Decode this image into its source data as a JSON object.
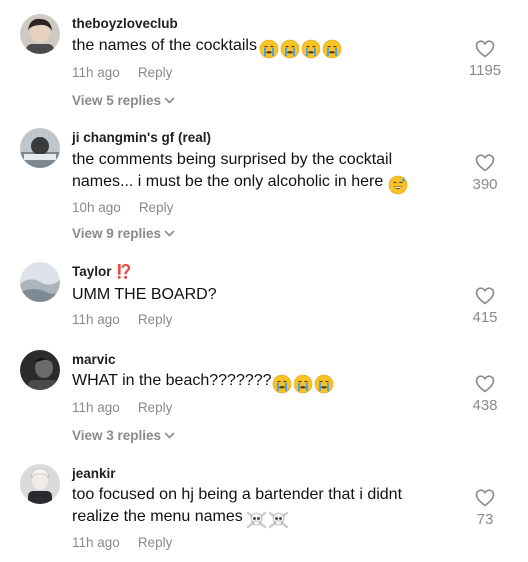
{
  "comments": [
    {
      "username": "theboyzloveclub",
      "badge": "",
      "text": "the names of the cocktails",
      "emojis": [
        "crying-face",
        "crying-face",
        "crying-face",
        "crying-face"
      ],
      "time": "11h ago",
      "reply_label": "Reply",
      "view_replies": "View 5 replies",
      "likes": "1195",
      "avatar_color": "#6b6b6b"
    },
    {
      "username": "ji changmin's gf (real)",
      "badge": "",
      "text_line1": "the comments being surprised by the cocktail",
      "text_line2": "names... i must be the only alcoholic in here",
      "emojis": [
        "sweat-smile-face"
      ],
      "time": "10h ago",
      "reply_label": "Reply",
      "view_replies": "View 9 replies",
      "likes": "390",
      "avatar_color": "#9aa3a8"
    },
    {
      "username": "Taylor",
      "badge": "⁉️",
      "text": "UMM THE BOARD?",
      "emojis": [],
      "time": "11h ago",
      "reply_label": "Reply",
      "view_replies": "",
      "likes": "415",
      "avatar_color": "#c8d0d6"
    },
    {
      "username": "marvic",
      "badge": "",
      "text": "WHAT in the beach???????",
      "emojis": [
        "crying-face",
        "crying-face",
        "crying-face"
      ],
      "time": "11h ago",
      "reply_label": "Reply",
      "view_replies": "View 3 replies",
      "likes": "438",
      "avatar_color": "#3a3a3a"
    },
    {
      "username": "jeankir",
      "badge": "",
      "text_line1": "too focused on hj being a bartender that i didnt",
      "text_line2": "realize the menu names",
      "emojis": [
        "skull-crossbones",
        "skull-crossbones"
      ],
      "time": "11h ago",
      "reply_label": "Reply",
      "view_replies": "",
      "likes": "73",
      "avatar_color": "#8e9196"
    }
  ],
  "colors": {
    "text": "#111111",
    "muted": "#8a8a8a",
    "badge": "#e0312b",
    "emoji_yellow": "#f7c325",
    "emoji_tear": "#4aa3e8"
  },
  "icons": {
    "like": "heart-outline-icon",
    "expand": "chevron-down-icon"
  }
}
